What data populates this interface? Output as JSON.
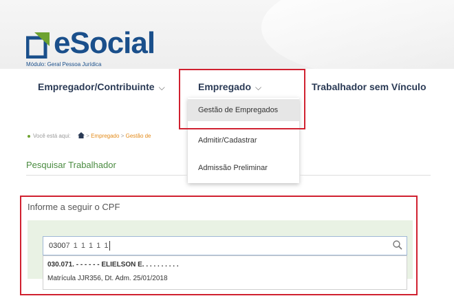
{
  "header": {
    "logo_text": "eSocial",
    "module_label": "Módulo: Geral Pessoa Jurídica",
    "colors": {
      "logo_blue": "#1a4f8b",
      "logo_green": "#6da230",
      "highlight_red": "#d0202f"
    }
  },
  "nav": {
    "items": [
      {
        "label": "Empregador/Contribuinte",
        "chevron": "chevron-down-icon"
      },
      {
        "label": "Empregado",
        "chevron": "chevron-down-icon"
      },
      {
        "label": "Trabalhador sem Vínculo"
      }
    ],
    "dropdown": [
      {
        "label": "Gestão de Empregados",
        "active": true
      },
      {
        "label": "Admitir/Cadastrar"
      },
      {
        "label": "Admissão Preliminar"
      }
    ]
  },
  "breadcrumb": {
    "prefix": "Você está aqui:",
    "home_icon": "home-icon",
    "sep1": ">",
    "item1": "Empregado",
    "sep2": ">",
    "item2": "Gestão de"
  },
  "section": {
    "title": "Pesquisar Trabalhador"
  },
  "form": {
    "label": "Informe a seguir o CPF",
    "cpf_value": "0300",
    "cpf_obscured": "7 1 1 1 1 1",
    "search_icon": "search-icon"
  },
  "suggestion": {
    "name": "030.071. - - - - - - ELIELSON E. . . . . . . . . .",
    "details": "Matrícula JJR356, Dt. Adm. 25/01/2018"
  }
}
